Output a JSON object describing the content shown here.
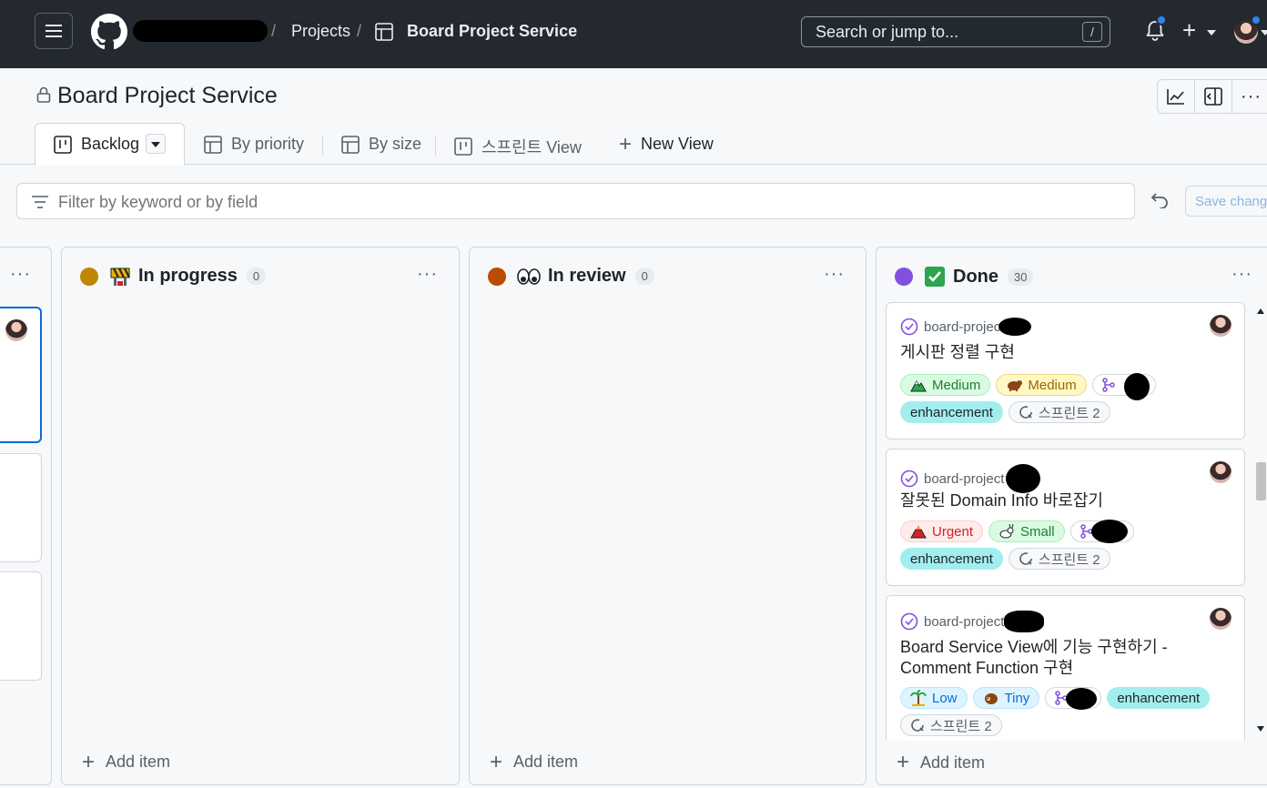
{
  "header": {
    "projects_label": "Projects",
    "project_name": "Board Project Service",
    "search_placeholder": "Search or jump to...",
    "search_shortcut": "/"
  },
  "page": {
    "title": "Board Project Service"
  },
  "tabs": [
    {
      "label": "Backlog",
      "icon": "board-icon",
      "selected": true
    },
    {
      "label": "By priority",
      "icon": "table-icon"
    },
    {
      "label": "By size",
      "icon": "table-icon"
    },
    {
      "label": "스프린트 View",
      "icon": "board-icon"
    },
    {
      "label": "New View",
      "icon": "plus-icon"
    }
  ],
  "filter": {
    "placeholder": "Filter by keyword or by field",
    "save_label": "Save changes"
  },
  "columns": [
    {
      "name": "In progress",
      "count": "0",
      "dot_color": "#bf8700",
      "add_label": "Add item"
    },
    {
      "name": "In review",
      "count": "0",
      "dot_color": "#bc4c00",
      "add_label": "Add item"
    },
    {
      "name": "Done",
      "count": "30",
      "dot_color": "#8250df",
      "add_label": "Add item"
    }
  ],
  "cards": [
    {
      "repo": "board-project",
      "title": "게시판 정렬 구현",
      "priority": "Medium",
      "size": "Medium",
      "label": "enhancement",
      "sprint": "스프린트 2"
    },
    {
      "repo": "board-project",
      "title": "잘못된 Domain Info 바로잡기",
      "priority": "Urgent",
      "size": "Small",
      "label": "enhancement",
      "sprint": "스프린트 2"
    },
    {
      "repo": "board-project",
      "title": "Board Service View에 기능 구현하기 - Comment Function 구현",
      "priority": "Low",
      "size": "Tiny",
      "label": "enhancement",
      "sprint": "스프린트 2"
    }
  ]
}
